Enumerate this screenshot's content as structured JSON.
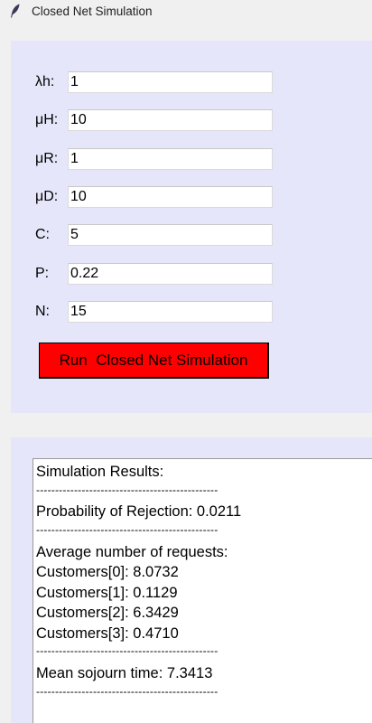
{
  "window": {
    "title": "Closed Net Simulation",
    "icon": "feather-icon"
  },
  "form": {
    "fields": [
      {
        "label": "λh:",
        "value": "1"
      },
      {
        "label": "μH:",
        "value": "10"
      },
      {
        "label": "μR:",
        "value": "1"
      },
      {
        "label": "μD:",
        "value": "10"
      },
      {
        "label": "C:",
        "value": "5"
      },
      {
        "label": "P:",
        "value": "0.22"
      },
      {
        "label": "N:",
        "value": "15"
      }
    ],
    "run_button_label": "Run  Closed Net Simulation",
    "run_button_color": "#ff0000"
  },
  "results": {
    "heading": "Simulation Results:",
    "separator": "------------------------------------------------",
    "rejection": "Probability of Rejection: 0.0211",
    "avg_heading": "Average number of requests:",
    "customers": [
      "Customers[0]: 8.0732",
      "Customers[1]: 0.1129",
      "Customers[2]: 6.3429",
      "Customers[3]: 0.4710"
    ],
    "sojourn": "Mean sojourn time: 7.3413"
  },
  "colors": {
    "panel_background": "#e6e6fa",
    "window_background": "#f0f0f0"
  }
}
